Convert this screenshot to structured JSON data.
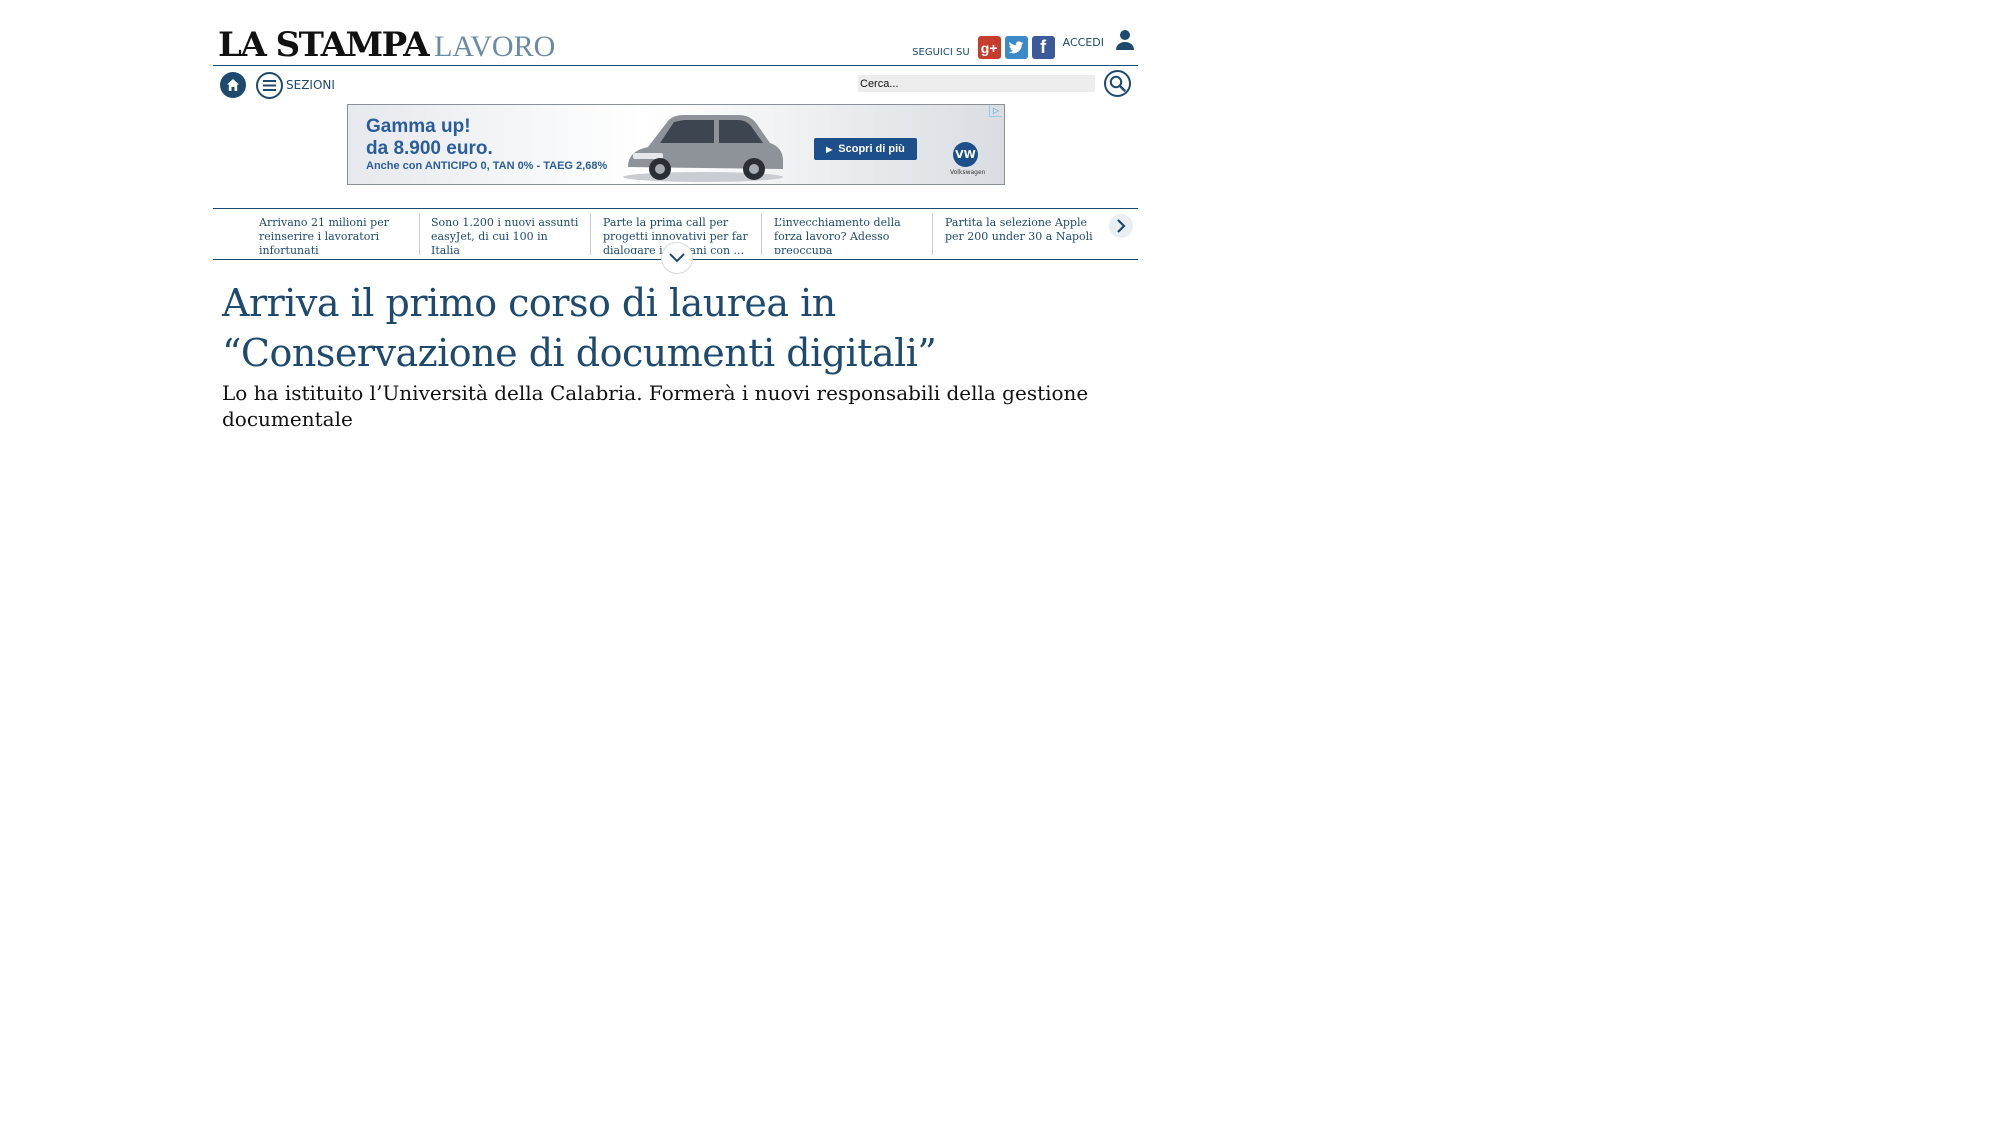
{
  "masthead": {
    "brand_main": "LA STAMPA",
    "brand_section": "LAVORO",
    "follow_label": "SEGUICI SU",
    "login_label": "ACCEDI"
  },
  "nav": {
    "sections_label": "SEZIONI",
    "search_placeholder": "Cerca..."
  },
  "ad": {
    "headline_1": "Gamma up!",
    "headline_2": "da 8.900 euro.",
    "fine_print": "Anche con ANTICIPO 0, TAN 0% - TAEG 2,68%",
    "cta": "Scopri di più",
    "brand": "Volkswagen"
  },
  "ticker": {
    "items": [
      "Arrivano 21 milioni per reinserire i lavoratori infortunati",
      "Sono 1.200 i nuovi assunti easyJet, di cui 100 in Italia",
      "Parte la prima call per progetti innovativi per far dialogare i giovani con ...",
      "L’invecchiamento della forza lavoro? Adesso preoccupa",
      "Partita la selezione Apple per 200 under 30 a Napoli"
    ]
  },
  "article": {
    "headline": "Arriva il primo corso di laurea in “Conservazione di documenti digitali”",
    "subtitle": "Lo ha istituito l’Università della Calabria. Formerà i nuovi responsabili della gestione documentale"
  },
  "colors": {
    "brand_blue": "#1e4a70",
    "ad_blue": "#2a5d9a",
    "gplus_red": "#c63d2d",
    "twitter_blue": "#3a89c9",
    "facebook_blue": "#3b5a9a"
  }
}
